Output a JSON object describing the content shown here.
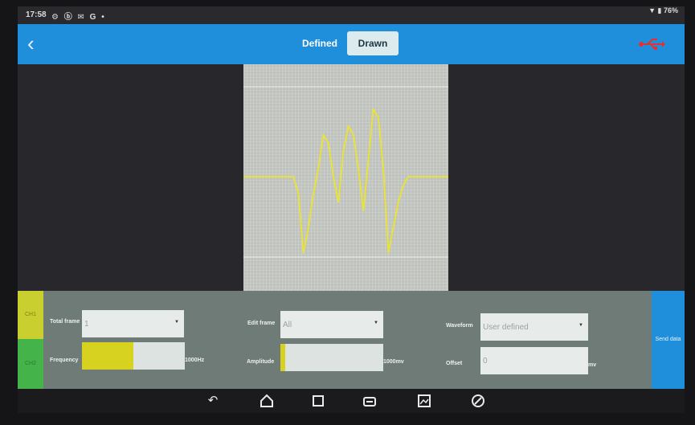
{
  "status": {
    "time": "17:58",
    "left_icons": "⚙ ⓑ ✉ G •",
    "right_icons": "▼ ▮ 76%"
  },
  "appbar": {
    "back_icon": "chevron-left",
    "tabs": [
      {
        "label": "Defined",
        "selected": false
      },
      {
        "label": "Drawn",
        "selected": true
      }
    ],
    "usb_icon_color": "#e53030",
    "accent": "#1f8fdc"
  },
  "waveform_preview": {
    "background": "#bfc2bd",
    "trace_color": "#e8e23a",
    "samples": [
      0,
      0,
      0,
      0,
      0,
      0,
      0,
      0,
      0,
      0,
      0,
      -0.2,
      -0.9,
      -0.6,
      -0.2,
      0.1,
      0.5,
      0.4,
      0.0,
      -0.3,
      0.3,
      0.6,
      0.5,
      0.1,
      -0.4,
      0.2,
      0.8,
      0.7,
      0.1,
      -0.9,
      -0.6,
      -0.3,
      -0.1,
      0,
      0,
      0,
      0,
      0,
      0,
      0,
      0,
      0
    ]
  },
  "controls": {
    "channels": [
      {
        "label": "CH1",
        "color": "#c9cf2f"
      },
      {
        "label": "CH2",
        "color": "#44b34a"
      }
    ],
    "total_frame": {
      "label": "Total frame",
      "value": "1"
    },
    "edit_frame": {
      "label": "Edit frame",
      "value": "All"
    },
    "waveform": {
      "label": "Waveform",
      "value": "User defined"
    },
    "frequency": {
      "label": "Frequency",
      "unit": "1000Hz",
      "fill_fraction": 0.5
    },
    "amplitude": {
      "label": "Amplitude",
      "unit": "1000mv",
      "fill_fraction": 0.05
    },
    "offset": {
      "label": "Offset",
      "value": "0",
      "unit": "mv"
    },
    "send_label": "Send data"
  },
  "navbar": {
    "icons": [
      "back-icon",
      "home-icon",
      "recents-icon",
      "screenshot-icon",
      "gallery-icon",
      "browser-icon"
    ]
  }
}
